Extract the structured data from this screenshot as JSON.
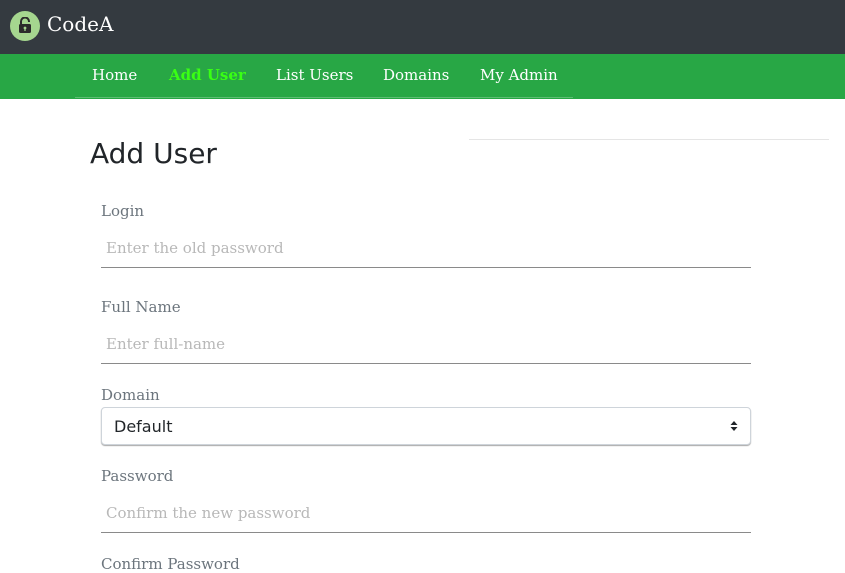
{
  "app": {
    "brand": "CodeA",
    "logo_icon": "lock-icon"
  },
  "nav": {
    "items": [
      {
        "label": "Home",
        "active": false
      },
      {
        "label": "Add User",
        "active": true
      },
      {
        "label": "List Users",
        "active": false
      },
      {
        "label": "Domains",
        "active": false
      },
      {
        "label": "My Admin",
        "active": false
      }
    ]
  },
  "page": {
    "title": "Add User"
  },
  "form": {
    "login": {
      "label": "Login",
      "placeholder": "Enter the old password",
      "value": ""
    },
    "full_name": {
      "label": "Full Name",
      "placeholder": "Enter full-name",
      "value": ""
    },
    "domain": {
      "label": "Domain",
      "selected": "Default"
    },
    "password": {
      "label": "Password",
      "placeholder": "Confirm the new password",
      "value": ""
    },
    "confirm_password": {
      "label": "Confirm Password"
    }
  },
  "colors": {
    "topbar": "#343a40",
    "navbar": "#28a745",
    "active_nav": "#39ff14",
    "logo_bg": "#a5d68f"
  }
}
